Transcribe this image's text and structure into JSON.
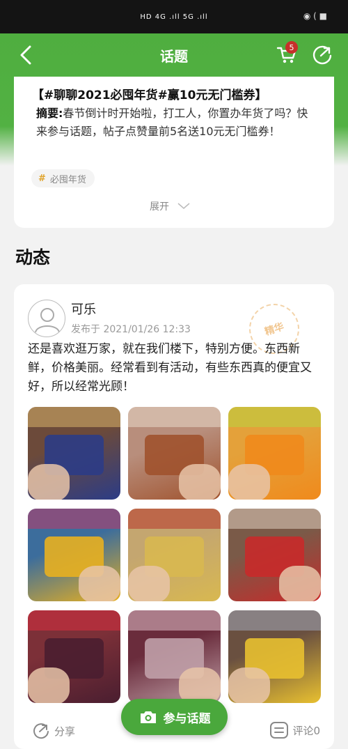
{
  "status_bar": {
    "left_signal": "HD 4G .ıll 5G .ıll",
    "right_icons": "◉ ( ■"
  },
  "nav": {
    "title": "话题",
    "cart_badge": "5",
    "icons": [
      "back-icon",
      "cart-icon",
      "share-icon"
    ]
  },
  "topic": {
    "title": "【#聊聊2021必囤年货#赢10元无门槛券】",
    "summary_label": "摘要:",
    "summary_text": "春节倒计时开始啦，打工人，你置办年货了吗？快来参与话题，帖子点赞量前5名送10元无门槛券！",
    "tag": "必囤年货",
    "tag_symbol": "#",
    "expand_label": "展开"
  },
  "section_title": "动态",
  "post": {
    "author": "可乐",
    "time": "发布于 2021/01/26 12:33",
    "stamp_text": "精华",
    "content": "还是喜欢逛万家，就在我们楼下，特别方便。东西新鲜，价格美丽。经常看到有活动，有些东西真的便宜又好，所以经常光顾！",
    "photos": [
      {
        "name": "photo-gift-box",
        "bg": "#6c4a3a",
        "main": "#2c3c86",
        "accent": "#d8b26a"
      },
      {
        "name": "photo-persimmons",
        "bg": "#b88e7c",
        "main": "#a0522d",
        "accent": "#e8d8c8"
      },
      {
        "name": "photo-oranges",
        "bg": "#e4a13a",
        "main": "#f08a1c",
        "accent": "#b8d640"
      },
      {
        "name": "photo-sunflowers",
        "bg": "#3c6d9c",
        "main": "#e8b020",
        "accent": "#c03868"
      },
      {
        "name": "photo-ferrero",
        "bg": "#c4a670",
        "main": "#d8b850",
        "accent": "#b8342c"
      },
      {
        "name": "photo-strawberries",
        "bg": "#7a5a48",
        "main": "#c82a2a",
        "accent": "#e0d0c0"
      },
      {
        "name": "photo-cherries",
        "bg": "#7c3038",
        "main": "#4a1e30",
        "accent": "#d83040"
      },
      {
        "name": "photo-snack-shelf",
        "bg": "#6a2c3c",
        "main": "#c0a0a8",
        "accent": "#e0c0c8"
      },
      {
        "name": "photo-mouse-snack",
        "bg": "#6a5040",
        "main": "#e8c030",
        "accent": "#a0a8b8"
      }
    ]
  },
  "footer": {
    "share_label": "分享",
    "comment_label": "评论0",
    "join_label": "参与话题"
  },
  "colors": {
    "brand_green": "#4fae3f",
    "badge_red": "#c7302a"
  }
}
